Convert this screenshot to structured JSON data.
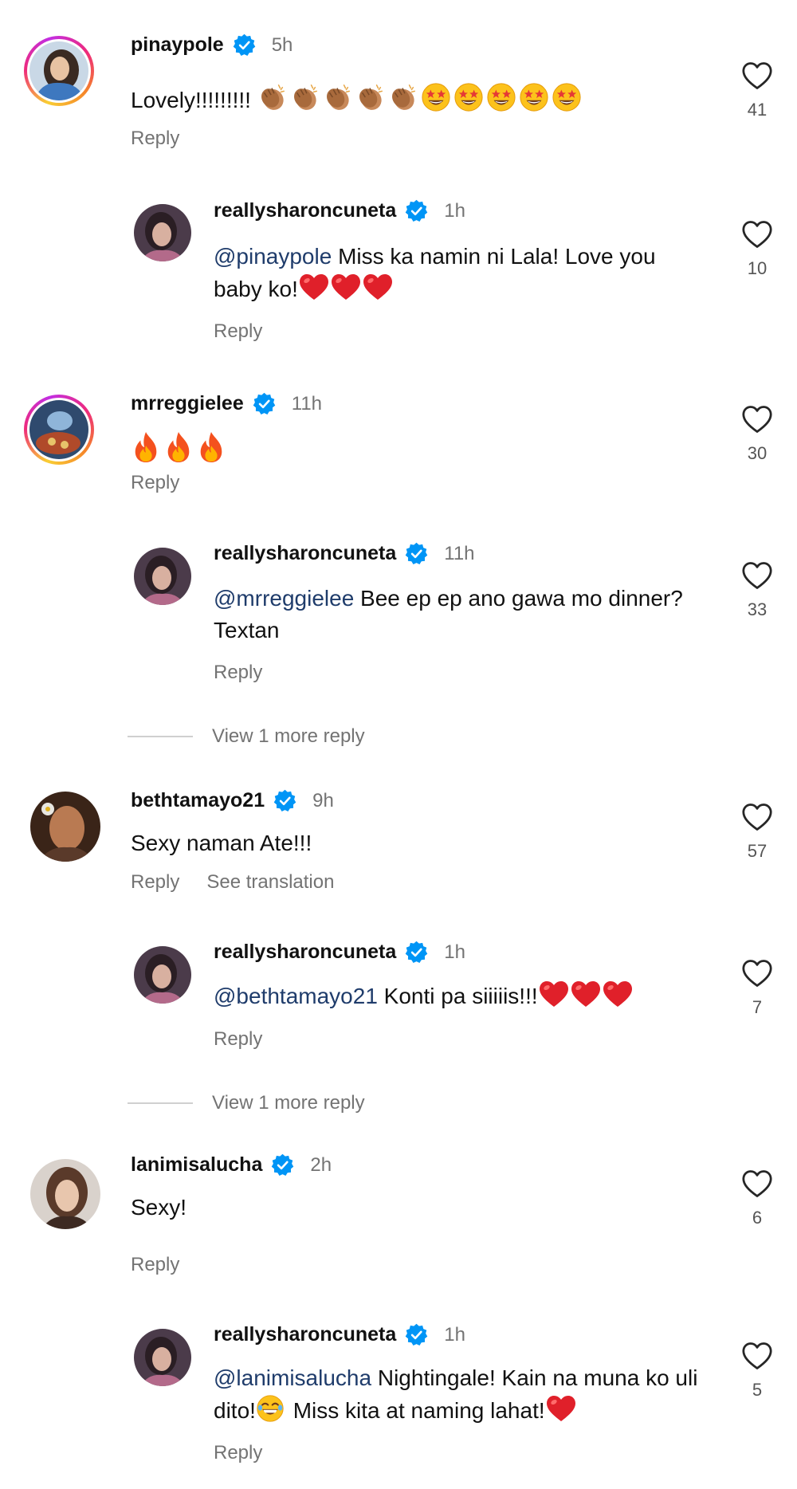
{
  "comments": [
    {
      "username": "pinaypole",
      "time": "5h",
      "text": "Lovely!!!!!!!!!",
      "likes": "41",
      "reply": "Reply"
    },
    {
      "username": "reallysharoncuneta",
      "time": "1h",
      "mention": "@pinaypole",
      "text": " Miss ka namin ni Lala! Love you baby ko!",
      "likes": "10",
      "reply": "Reply"
    },
    {
      "username": "mrreggielee",
      "time": "11h",
      "likes": "30",
      "reply": "Reply"
    },
    {
      "username": "reallysharoncuneta",
      "time": "11h",
      "mention": "@mrreggielee",
      "text": " Bee ep ep ano gawa mo dinner? Textan",
      "likes": "33",
      "reply": "Reply"
    },
    {
      "username": "bethtamayo21",
      "time": "9h",
      "text": "Sexy naman Ate!!!",
      "likes": "57",
      "reply": "Reply",
      "translate": "See translation"
    },
    {
      "username": "reallysharoncuneta",
      "time": "1h",
      "mention": "@bethtamayo21",
      "text": " Konti pa siiiiis!!!",
      "likes": "7",
      "reply": "Reply"
    },
    {
      "username": "lanimisalucha",
      "time": "2h",
      "text": "Sexy!",
      "likes": "6",
      "reply": "Reply"
    },
    {
      "username": "reallysharoncuneta",
      "time": "1h",
      "mention": "@lanimisalucha",
      "text": " Nightingale! Kain na muna ko uli dito!",
      "text2": " Miss kita at naming lahat!",
      "likes": "5",
      "reply": "Reply"
    }
  ],
  "view_more": [
    "View 1 more reply",
    "View 1 more reply"
  ],
  "icons": {
    "verified": "verified-badge-icon",
    "like": "heart-outline-icon"
  },
  "colors": {
    "verified": "#0095f6",
    "muted": "#737373",
    "mention": "#1f3c6b",
    "heart": "#e0202a"
  }
}
